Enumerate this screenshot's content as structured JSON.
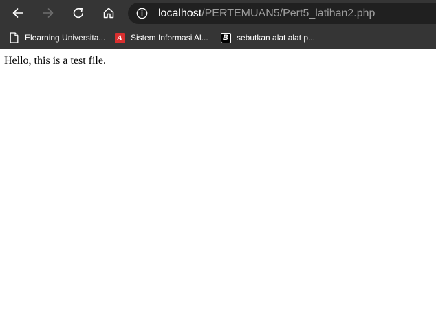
{
  "browser": {
    "address_bar": {
      "host": "localhost",
      "path": "/PERTEMUAN5/Pert5_latihan2.php"
    },
    "nav": {
      "back_icon": "arrow-left-icon",
      "forward_icon": "arrow-right-icon",
      "reload_icon": "reload-icon",
      "home_icon": "home-icon",
      "info_icon": "info-icon"
    },
    "bookmarks": [
      {
        "label": "Elearning Universita...",
        "icon": "page-icon"
      },
      {
        "label": "Sistem Informasi Al...",
        "icon": "red-a-icon",
        "icon_text": "A"
      },
      {
        "label": "sebutkan alat alat p...",
        "icon": "black-b-icon",
        "icon_text": "B"
      }
    ]
  },
  "page": {
    "text": "Hello, this is a test file."
  },
  "colors": {
    "chrome_bg": "#353535",
    "address_bg": "#202020",
    "url_host": "#ffffff",
    "url_path": "#9d9d9d",
    "disabled_icon": "#6e6e6e",
    "page_bg": "#ffffff"
  }
}
